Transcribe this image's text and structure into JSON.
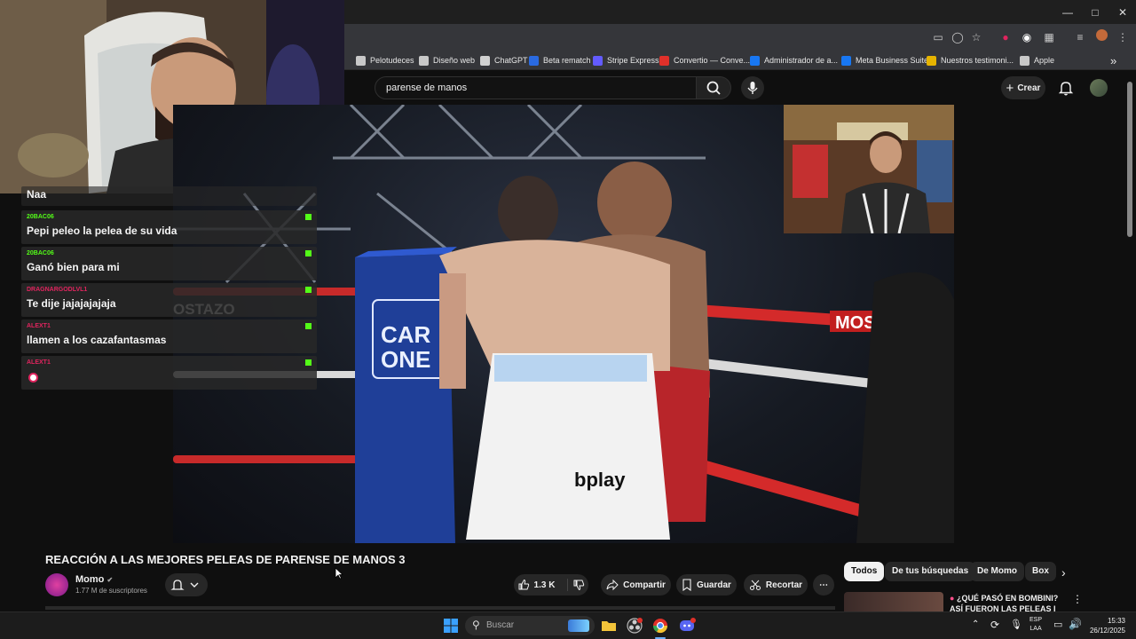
{
  "browser": {
    "bookmarks": [
      {
        "label": "Pelotudeces",
        "color": "#c8c8c8"
      },
      {
        "label": "Diseño web",
        "color": "#c8c8c8"
      },
      {
        "label": "ChatGPT",
        "color": "#d0d0d0"
      },
      {
        "label": "Beta rematch",
        "color": "#2a6ae0"
      },
      {
        "label": "Stripe Express",
        "color": "#635bff"
      },
      {
        "label": "Convertio — Conve...",
        "color": "#e0302a"
      },
      {
        "label": "Administrador de a...",
        "color": "#1877f2"
      },
      {
        "label": "Meta Business Suite",
        "color": "#1877f2"
      },
      {
        "label": "Nuestros testimoni...",
        "color": "#e6b400"
      },
      {
        "label": "Apple",
        "color": "#c8c8c8"
      }
    ]
  },
  "youtube": {
    "search_query": "parense de manos",
    "create_label": "Crear",
    "video_title": "REACCIÓN A LAS MEJORES PELEAS DE PARENSE DE MANOS 3",
    "channel_name": "Momo",
    "channel_subs": "1.77 M de suscriptores",
    "likes": "1.3 K",
    "share_label": "Compartir",
    "save_label": "Guardar",
    "clip_label": "Recortar",
    "chips": [
      "Todos",
      "De tus búsquedas",
      "De Momo",
      "Box"
    ],
    "rec_title": "¿QUÉ PASÓ EN BOMBINI? ASÍ FUERON LAS PELEAS I"
  },
  "chat": [
    {
      "user": "",
      "text": "Naa",
      "color": "#53fc18"
    },
    {
      "user": "20BAC06",
      "text": "Pepi peleo la pelea de su vida",
      "color": "#53fc18"
    },
    {
      "user": "20BAC06",
      "text": "Ganó bien para mi",
      "color": "#53fc18"
    },
    {
      "user": "DRAGNARGODLVL1",
      "text": "Te dije jajajajajaja",
      "color": "#e0245e"
    },
    {
      "user": "ALEXT1",
      "text": "llamen a los cazafantasmas",
      "color": "#e0245e"
    },
    {
      "user": "ALEXT1",
      "text": "",
      "color": "#e0245e"
    }
  ],
  "video_overlay": {
    "post_text": "CAR ONE",
    "shorts_brand": "bplay",
    "rope_brand": "MOS",
    "rope_brand_left": "OSTAZO"
  },
  "taskbar": {
    "search_placeholder": "Buscar",
    "lang_top": "ESP",
    "lang_bottom": "LAA",
    "time": "15:33",
    "date": "26/12/2025"
  }
}
